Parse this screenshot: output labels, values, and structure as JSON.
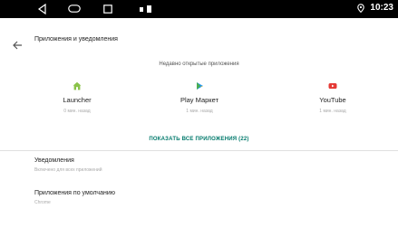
{
  "status_bar": {
    "time": "10:23"
  },
  "header": {
    "title": "Приложения и уведомления"
  },
  "recent": {
    "title": "Недавно открытые приложения",
    "apps": [
      {
        "name": "Launcher",
        "time": "0 мин. назад",
        "icon": "home-icon"
      },
      {
        "name": "Play Маркет",
        "time": "1 мин. назад",
        "icon": "play-store-icon"
      },
      {
        "name": "YouTube",
        "time": "1 мин. назад",
        "icon": "youtube-icon"
      }
    ],
    "show_all": "ПОКАЗАТЬ ВСЕ ПРИЛОЖЕНИЯ (22)"
  },
  "settings": [
    {
      "title": "Уведомления",
      "subtitle": "Включено для всех приложений"
    },
    {
      "title": "Приложения по умолчанию",
      "subtitle": "Chrome"
    }
  ],
  "colors": {
    "accent": "#00796b",
    "launcher_icon": "#8bc34a",
    "youtube": "#e53935",
    "status_bar": "#000000"
  }
}
